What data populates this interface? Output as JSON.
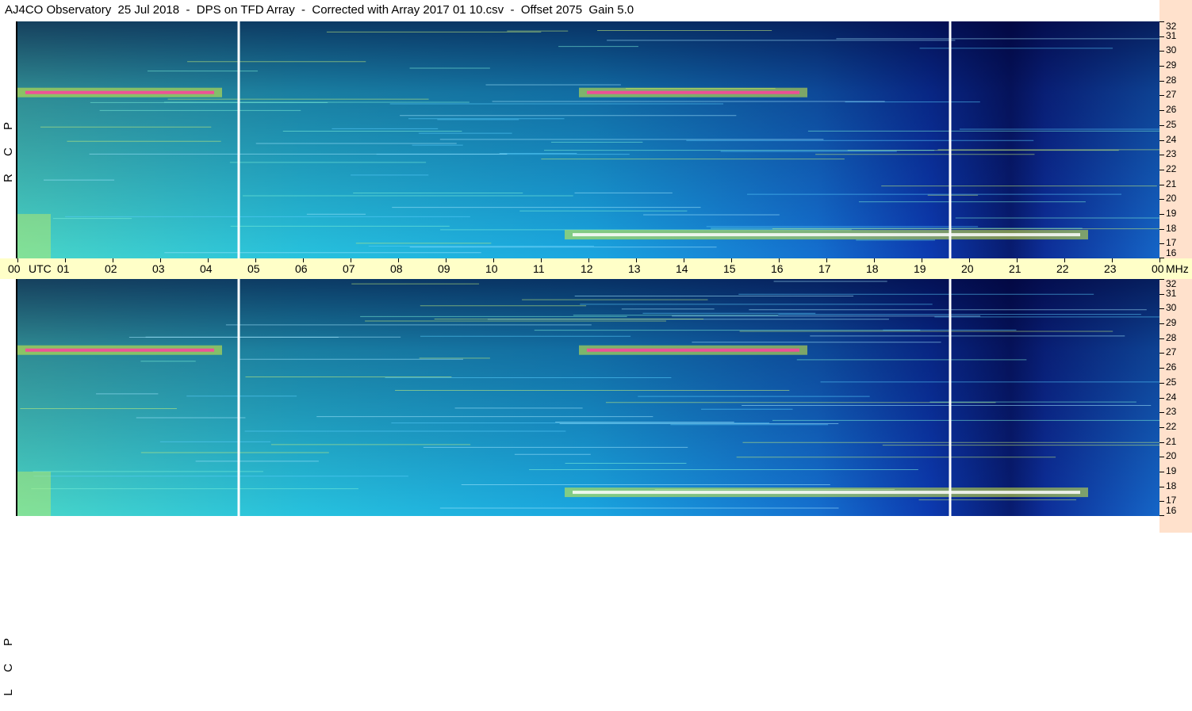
{
  "title": "AJ4CO Observatory  25 Jul 2018  -  DPS on TFD Array  -  Corrected with Array 2017 01 10.csv  -  Offset 2075  Gain 5.0",
  "colors": {
    "axis_time_bg": "#ffffc8",
    "axis_freq_bg": "#ffe1cc",
    "low_intensity": "#000010",
    "mid_intensity": "#1a8fd8",
    "high_intensity": "#ffffff"
  },
  "chart_data": [
    {
      "type": "heatmap",
      "panel": "RCP",
      "polarization_label": "R C P",
      "x_units": "UTC hour",
      "y_units": "MHz",
      "xlim": [
        0,
        24
      ],
      "ylim": [
        16,
        32
      ],
      "x_ticks": [
        "00",
        "01",
        "02",
        "03",
        "04",
        "05",
        "06",
        "07",
        "08",
        "09",
        "10",
        "11",
        "12",
        "13",
        "14",
        "15",
        "16",
        "17",
        "18",
        "19",
        "20",
        "21",
        "22",
        "23",
        "00"
      ],
      "y_ticks": [
        "16",
        "17",
        "18",
        "19",
        "20",
        "21",
        "22",
        "23",
        "24",
        "25",
        "26",
        "27",
        "28",
        "29",
        "30",
        "31",
        "32"
      ],
      "gaps_utc": [
        4.65,
        19.6
      ],
      "bright_bands": [
        {
          "freq_mhz": 27.2,
          "start_utc": 0.0,
          "end_utc": 4.3
        },
        {
          "freq_mhz": 27.2,
          "start_utc": 11.8,
          "end_utc": 16.6
        },
        {
          "freq_mhz": 17.6,
          "start_utc": 11.5,
          "end_utc": 22.5
        }
      ]
    },
    {
      "type": "heatmap",
      "panel": "LCP",
      "polarization_label": "L C P",
      "x_units": "UTC hour",
      "y_units": "MHz",
      "xlim": [
        0,
        24
      ],
      "ylim": [
        16,
        32
      ],
      "x_ticks": [
        "00",
        "01",
        "02",
        "03",
        "04",
        "05",
        "06",
        "07",
        "08",
        "09",
        "10",
        "11",
        "12",
        "13",
        "14",
        "15",
        "16",
        "17",
        "18",
        "19",
        "20",
        "21",
        "22",
        "23",
        "00"
      ],
      "y_ticks": [
        "16",
        "17",
        "18",
        "19",
        "20",
        "21",
        "22",
        "23",
        "24",
        "25",
        "26",
        "27",
        "28",
        "29",
        "30",
        "31",
        "32"
      ],
      "gaps_utc": [
        4.65,
        19.6
      ],
      "bright_bands": [
        {
          "freq_mhz": 27.2,
          "start_utc": 0.0,
          "end_utc": 4.3
        },
        {
          "freq_mhz": 27.2,
          "start_utc": 11.8,
          "end_utc": 16.6
        },
        {
          "freq_mhz": 17.6,
          "start_utc": 11.5,
          "end_utc": 22.5
        }
      ]
    }
  ],
  "time_axis": {
    "utc_label": "UTC",
    "mhz_label": "MHz"
  }
}
